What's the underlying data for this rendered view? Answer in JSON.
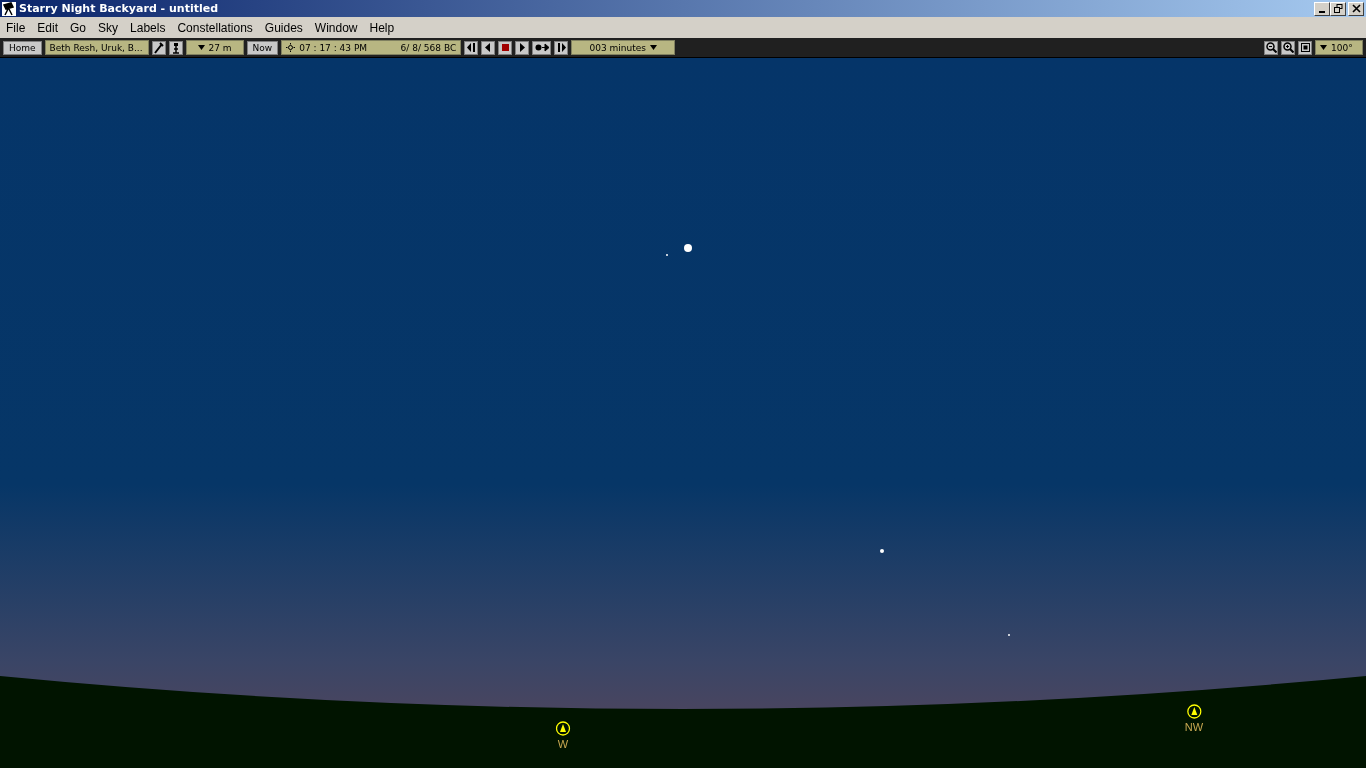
{
  "window": {
    "title": "Starry Night Backyard - untitled"
  },
  "menu": [
    "File",
    "Edit",
    "Go",
    "Sky",
    "Labels",
    "Constellations",
    "Guides",
    "Window",
    "Help"
  ],
  "toolbar": {
    "home": "Home",
    "location": "Beth Resh, Uruk, B...",
    "elevation": "27 m",
    "now": "Now",
    "time": "07 : 17 : 43 PM",
    "date": "6/  8/  568 BC",
    "step": "003 minutes",
    "field_of_view": "100°"
  },
  "compass": [
    {
      "label": "W"
    },
    {
      "label": "NW"
    }
  ]
}
